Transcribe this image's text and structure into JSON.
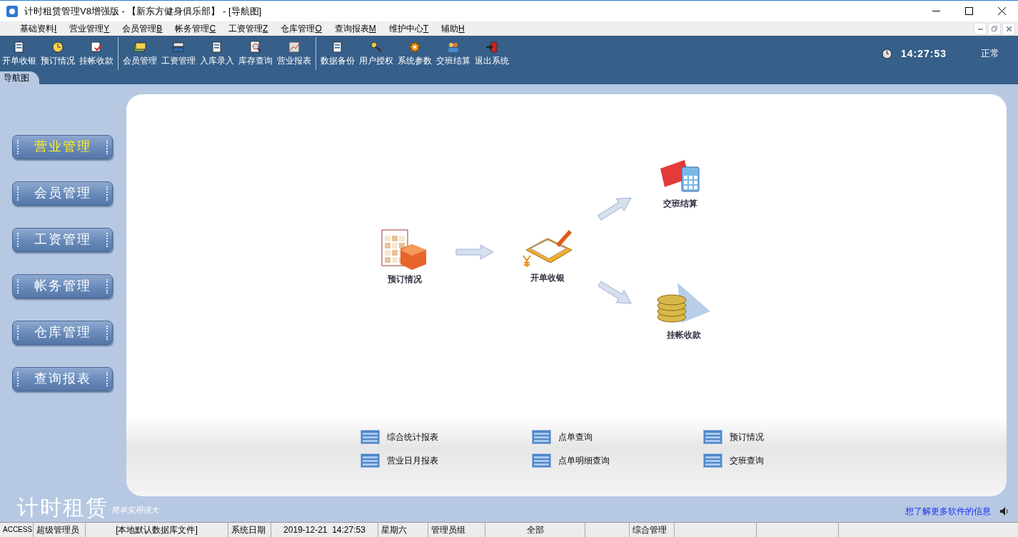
{
  "window": {
    "title": "计时租赁管理V8增强版 - 【新东方健身俱乐部】 - [导航图]"
  },
  "menu": [
    {
      "label": "基础资料",
      "key": "I"
    },
    {
      "label": "营业管理",
      "key": "Y"
    },
    {
      "label": "会员管理",
      "key": "B"
    },
    {
      "label": "帐务管理",
      "key": "C"
    },
    {
      "label": "工资管理",
      "key": "Z"
    },
    {
      "label": "仓库管理",
      "key": "O"
    },
    {
      "label": "查询报表",
      "key": "M"
    },
    {
      "label": "维护中心",
      "key": "T"
    },
    {
      "label": "辅助",
      "key": "H"
    }
  ],
  "toolbar": {
    "groups": [
      [
        {
          "label": "开单收银",
          "kind": "doc"
        },
        {
          "label": "预订情况",
          "kind": "clock"
        },
        {
          "label": "挂帐收款",
          "kind": "check"
        }
      ],
      [
        {
          "label": "会员管理",
          "kind": "cards"
        },
        {
          "label": "工资管理",
          "kind": "swap"
        },
        {
          "label": "入库录入",
          "kind": "doc"
        },
        {
          "label": "库存查询",
          "kind": "search"
        },
        {
          "label": "营业报表",
          "kind": "chart"
        }
      ],
      [
        {
          "label": "数据备份",
          "kind": "doc"
        },
        {
          "label": "用户授权",
          "kind": "key"
        },
        {
          "label": "系统参数",
          "kind": "gear"
        },
        {
          "label": "交班结算",
          "kind": "people"
        },
        {
          "label": "退出系统",
          "kind": "exit"
        }
      ]
    ],
    "clock": "14:27:53",
    "status": "正常"
  },
  "tabs": [
    {
      "label": "导航图",
      "selected": true
    }
  ],
  "sidebar": {
    "items": [
      {
        "label": "营业管理",
        "selected": true
      },
      {
        "label": "会员管理",
        "selected": false
      },
      {
        "label": "工资管理",
        "selected": false
      },
      {
        "label": "帐务管理",
        "selected": false
      },
      {
        "label": "仓库管理",
        "selected": false
      },
      {
        "label": "查询报表",
        "selected": false
      }
    ]
  },
  "flow": {
    "nodes": [
      {
        "label": "预订情况",
        "kind": "calendar"
      },
      {
        "label": "开单收银",
        "kind": "cashier"
      },
      {
        "label": "交班结算",
        "kind": "card"
      },
      {
        "label": "挂帐收款",
        "kind": "coins"
      }
    ]
  },
  "reports": [
    "综合统计报表",
    "点单查询",
    "预订情况",
    "营业日月报表",
    "点单明细查询",
    "交班查询"
  ],
  "brand": {
    "name": "计时租赁",
    "slogan": "简单实用强大"
  },
  "info_link": "想了解更多软件的信息",
  "status_bar": [
    "ACCESS",
    "超级管理员",
    "[本地默认数据库文件]",
    "系统日期",
    "2019-12-21  14:27:53",
    "星期六",
    "管理员组",
    "全部",
    "综合管理"
  ]
}
